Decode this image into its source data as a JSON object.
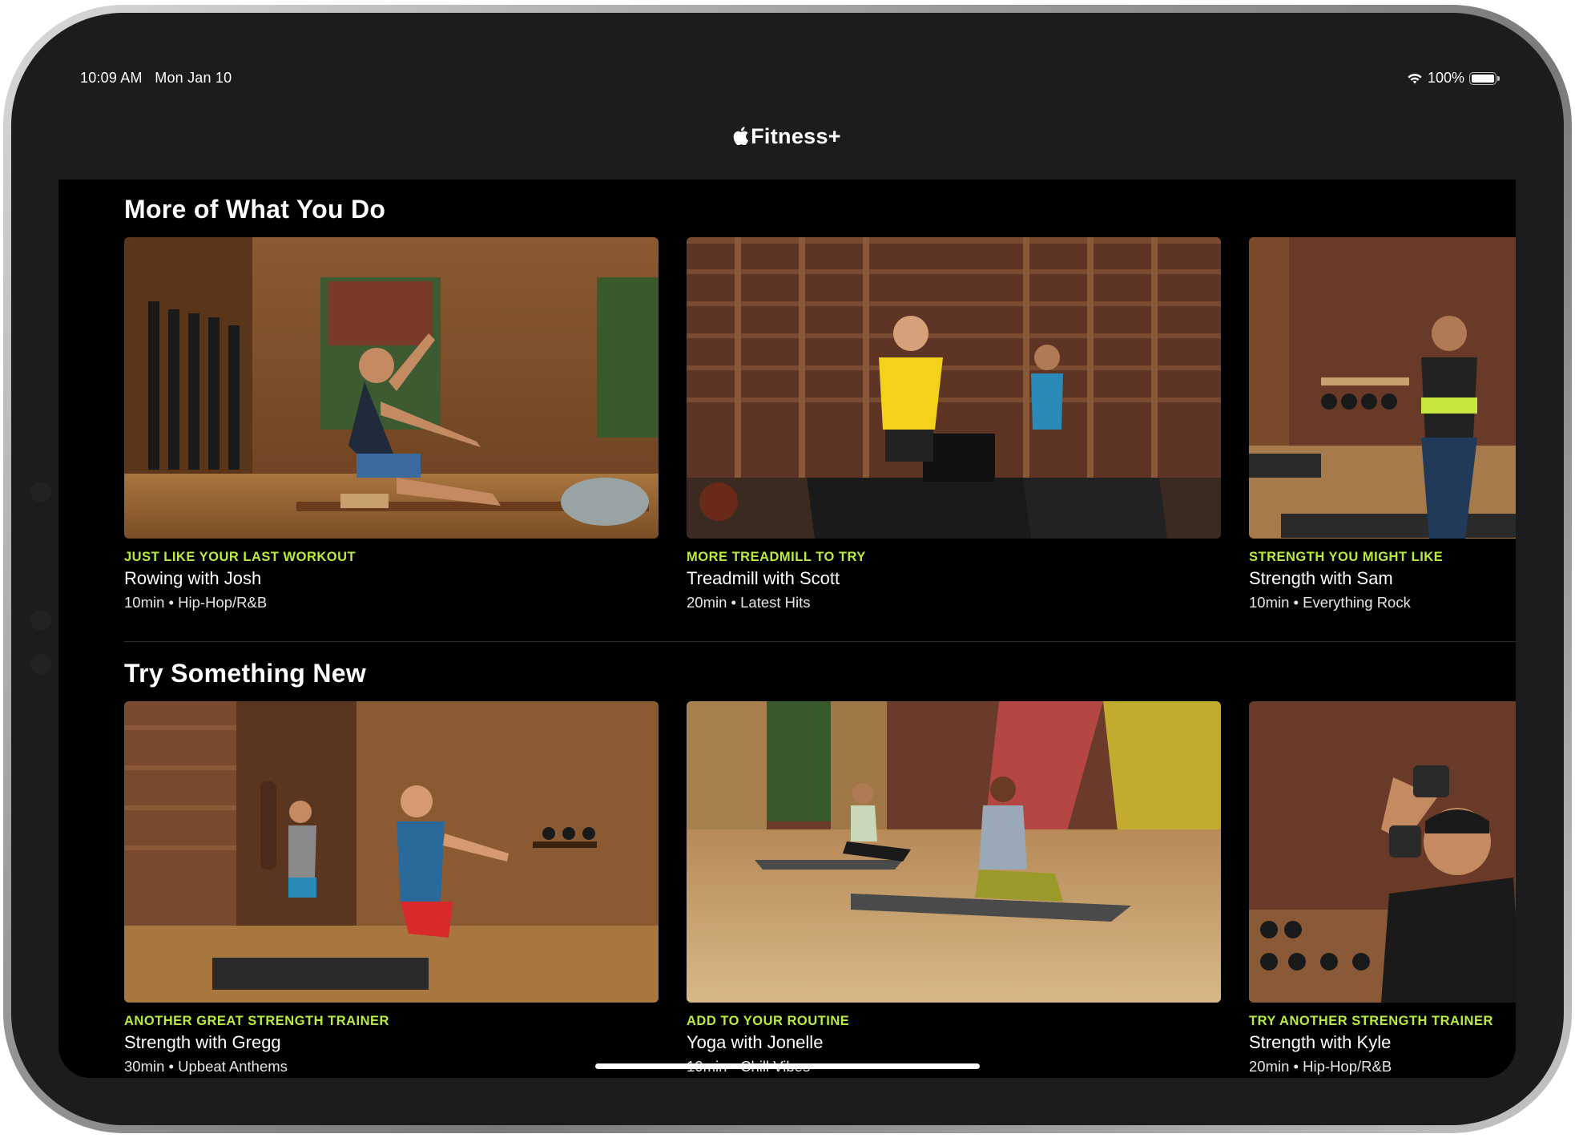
{
  "status_bar": {
    "time": "10:09 AM",
    "date": "Mon Jan 10",
    "battery": "100%",
    "battery_level": 1.0
  },
  "header": {
    "brand": "Fitness+"
  },
  "sections": [
    {
      "title": "More of What You Do",
      "cards": [
        {
          "kicker": "JUST LIKE YOUR LAST WORKOUT",
          "title": "Rowing with Josh",
          "meta": "10min • Hip-Hop/R&B"
        },
        {
          "kicker": "MORE TREADMILL TO TRY",
          "title": "Treadmill with Scott",
          "meta": "20min • Latest Hits"
        },
        {
          "kicker": "STRENGTH YOU MIGHT LIKE",
          "title": "Strength with Sam",
          "meta": "10min • Everything Rock"
        }
      ]
    },
    {
      "title": "Try Something New",
      "cards": [
        {
          "kicker": "ANOTHER GREAT STRENGTH TRAINER",
          "title": "Strength with Gregg",
          "meta": "30min • Upbeat Anthems"
        },
        {
          "kicker": "ADD TO YOUR ROUTINE",
          "title": "Yoga with Jonelle",
          "meta": "10min • Chill Vibes"
        },
        {
          "kicker": "TRY ANOTHER STRENGTH TRAINER",
          "title": "Strength with Kyle",
          "meta": "20min • Hip-Hop/R&B"
        }
      ]
    }
  ],
  "colors": {
    "accent": "#b8ec3a",
    "background": "#000000",
    "header_bg": "#1c1c1e"
  }
}
